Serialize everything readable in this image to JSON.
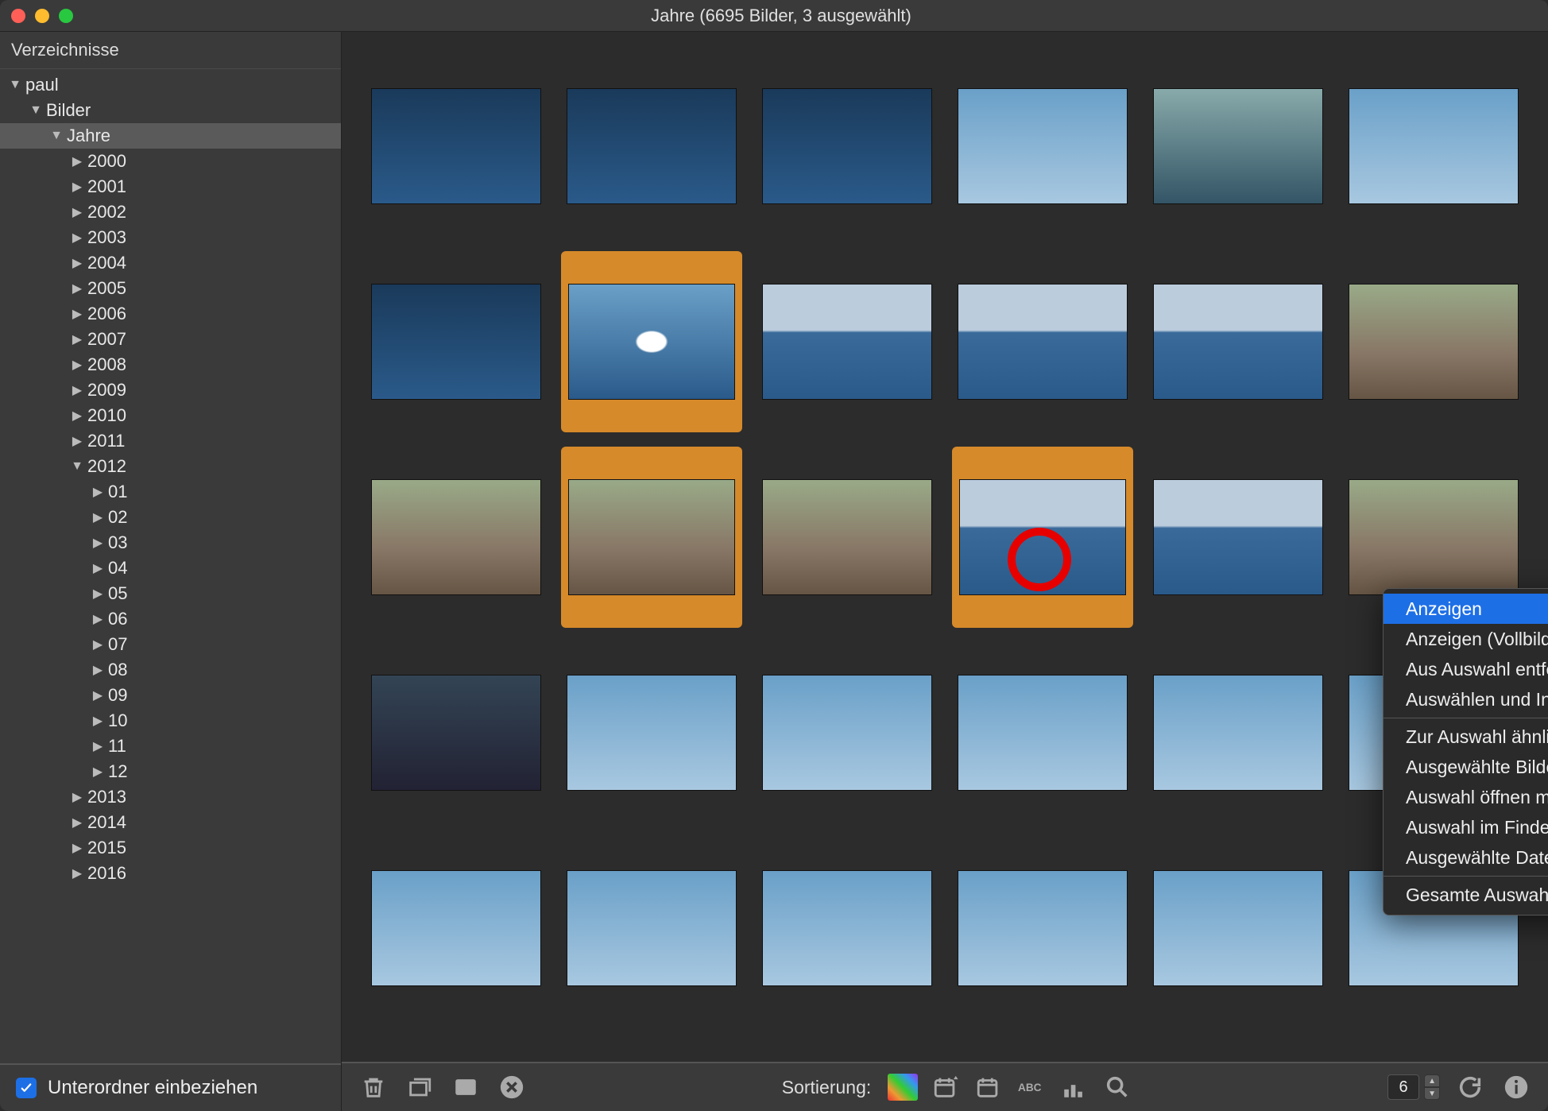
{
  "window": {
    "title": "Jahre (6695 Bilder, 3 ausgewählt)"
  },
  "sidebar": {
    "header": "Verzeichnisse",
    "tree": [
      {
        "label": "paul",
        "depth": 0,
        "expanded": true
      },
      {
        "label": "Bilder",
        "depth": 1,
        "expanded": true
      },
      {
        "label": "Jahre",
        "depth": 2,
        "expanded": true,
        "selected": true
      },
      {
        "label": "2000",
        "depth": 3,
        "expanded": false
      },
      {
        "label": "2001",
        "depth": 3,
        "expanded": false
      },
      {
        "label": "2002",
        "depth": 3,
        "expanded": false
      },
      {
        "label": "2003",
        "depth": 3,
        "expanded": false
      },
      {
        "label": "2004",
        "depth": 3,
        "expanded": false
      },
      {
        "label": "2005",
        "depth": 3,
        "expanded": false
      },
      {
        "label": "2006",
        "depth": 3,
        "expanded": false
      },
      {
        "label": "2007",
        "depth": 3,
        "expanded": false
      },
      {
        "label": "2008",
        "depth": 3,
        "expanded": false
      },
      {
        "label": "2009",
        "depth": 3,
        "expanded": false
      },
      {
        "label": "2010",
        "depth": 3,
        "expanded": false
      },
      {
        "label": "2011",
        "depth": 3,
        "expanded": false
      },
      {
        "label": "2012",
        "depth": 3,
        "expanded": true
      },
      {
        "label": "01",
        "depth": 4,
        "expanded": false
      },
      {
        "label": "02",
        "depth": 4,
        "expanded": false
      },
      {
        "label": "03",
        "depth": 4,
        "expanded": false
      },
      {
        "label": "04",
        "depth": 4,
        "expanded": false
      },
      {
        "label": "05",
        "depth": 4,
        "expanded": false
      },
      {
        "label": "06",
        "depth": 4,
        "expanded": false
      },
      {
        "label": "07",
        "depth": 4,
        "expanded": false
      },
      {
        "label": "08",
        "depth": 4,
        "expanded": false
      },
      {
        "label": "09",
        "depth": 4,
        "expanded": false
      },
      {
        "label": "10",
        "depth": 4,
        "expanded": false
      },
      {
        "label": "11",
        "depth": 4,
        "expanded": false
      },
      {
        "label": "12",
        "depth": 4,
        "expanded": false
      },
      {
        "label": "2013",
        "depth": 3,
        "expanded": false
      },
      {
        "label": "2014",
        "depth": 3,
        "expanded": false
      },
      {
        "label": "2015",
        "depth": 3,
        "expanded": false
      },
      {
        "label": "2016",
        "depth": 3,
        "expanded": false
      }
    ],
    "footer": {
      "checkbox_checked": true,
      "label": "Unterordner einbeziehen"
    }
  },
  "grid": {
    "thumbnails": [
      {
        "look": "water",
        "selected": false
      },
      {
        "look": "water",
        "selected": false
      },
      {
        "look": "water",
        "selected": false
      },
      {
        "look": "sky",
        "selected": false
      },
      {
        "look": "lake",
        "selected": false
      },
      {
        "look": "sky",
        "selected": false
      },
      {
        "look": "water",
        "selected": false
      },
      {
        "look": "bird",
        "selected": true
      },
      {
        "look": "coast",
        "selected": false
      },
      {
        "look": "coast",
        "selected": false
      },
      {
        "look": "coast",
        "selected": false
      },
      {
        "look": "rocks",
        "selected": false
      },
      {
        "look": "rocks",
        "selected": false
      },
      {
        "look": "rocks",
        "selected": true
      },
      {
        "look": "rocks",
        "selected": false
      },
      {
        "look": "coast",
        "selected": true,
        "ring": true
      },
      {
        "look": "coast",
        "selected": false
      },
      {
        "look": "rocks",
        "selected": false
      },
      {
        "look": "dark",
        "selected": false
      },
      {
        "look": "sky",
        "selected": false
      },
      {
        "look": "sky",
        "selected": false
      },
      {
        "look": "sky",
        "selected": false
      },
      {
        "look": "sky",
        "selected": false
      },
      {
        "look": "sky",
        "selected": false
      },
      {
        "look": "sky",
        "selected": false
      },
      {
        "look": "sky",
        "selected": false
      },
      {
        "look": "sky",
        "selected": false
      },
      {
        "look": "sky",
        "selected": false
      },
      {
        "look": "sky",
        "selected": false
      },
      {
        "look": "sky",
        "selected": false
      }
    ]
  },
  "context_menu": {
    "groups": [
      [
        {
          "label": "Anzeigen",
          "highlight": true
        },
        {
          "label": "Anzeigen (Vollbild)"
        },
        {
          "label": "Aus Auswahl entfernen"
        },
        {
          "label": "Auswählen und Informationen anzeigen"
        }
      ],
      [
        {
          "label": "Zur Auswahl ähnliche finden"
        },
        {
          "label": "Ausgewählte Bilder mit Vorschau öffnen"
        },
        {
          "label": "Auswahl öffnen mit",
          "submenu": true
        },
        {
          "label": "Auswahl im Finder anzeigen"
        },
        {
          "label": "Ausgewählte Dateien löschen"
        }
      ],
      [
        {
          "label": "Gesamte Auswahl aufheben"
        }
      ]
    ]
  },
  "bottombar": {
    "sort_label": "Sortierung:",
    "columns_value": "6",
    "buttons_left": [
      "trash-icon",
      "stack-icon",
      "fullscreen-icon",
      "cancel-icon"
    ],
    "sort_buttons": [
      "rainbow-sort-icon",
      "calendar-desc-icon",
      "calendar-asc-icon",
      "abc-sort-icon",
      "bars-sort-icon",
      "search-icon"
    ],
    "buttons_right": [
      "refresh-icon",
      "info-icon"
    ]
  }
}
